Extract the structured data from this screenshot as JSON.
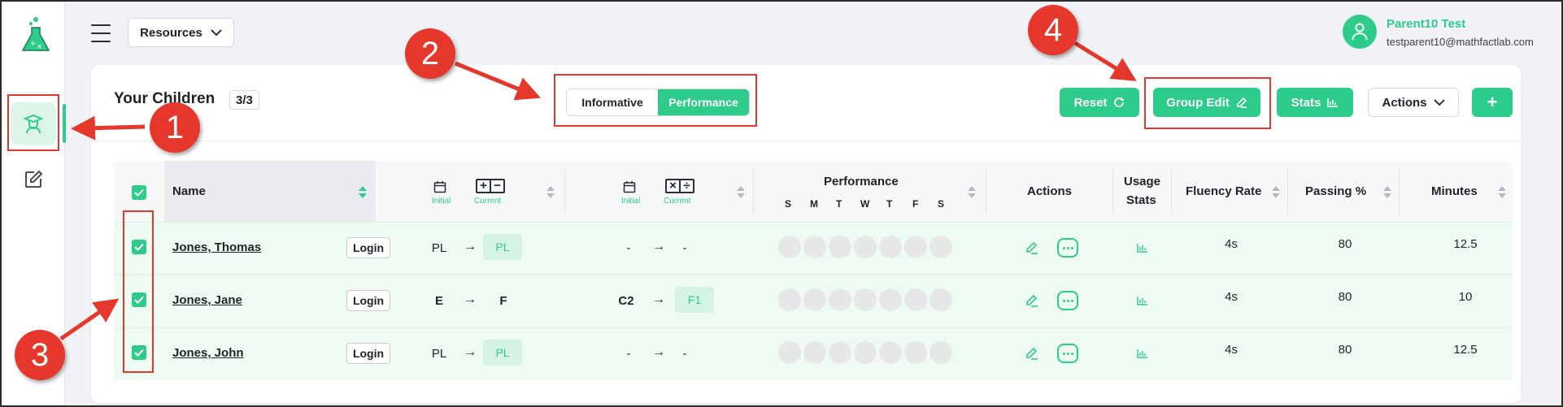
{
  "header": {
    "resources_label": "Resources",
    "user_name": "Parent10 Test",
    "user_email": "testparent10@mathfactlab.com"
  },
  "card": {
    "title": "Your Children",
    "count": "3/3",
    "view_toggle": [
      "Informative",
      "Performance"
    ],
    "active_view": "Performance",
    "buttons": {
      "reset": "Reset",
      "group_edit": "Group Edit",
      "stats": "Stats",
      "actions": "Actions",
      "add": "+"
    }
  },
  "table": {
    "headers": {
      "name": "Name",
      "performance": "Performance",
      "actions": "Actions",
      "usage_stats_1": "Usage",
      "usage_stats_2": "Stats",
      "fluency_rate": "Fluency Rate",
      "passing": "Passing %",
      "minutes": "Minutes",
      "initial": "Initial",
      "current": "Current",
      "days": [
        "S",
        "M",
        "T",
        "W",
        "T",
        "F",
        "S"
      ],
      "addsub_symbols": [
        "+",
        "−"
      ],
      "muldiv_symbols": [
        "×",
        "÷"
      ]
    },
    "rows": [
      {
        "name": "Jones, Thomas",
        "login": "Login",
        "as_initial": "PL",
        "as_current": "PL",
        "md_initial": "-",
        "md_current": "-",
        "fluency": "4s",
        "passing": "80",
        "minutes": "12.5"
      },
      {
        "name": "Jones, Jane",
        "login": "Login",
        "as_initial": "E",
        "as_current": "F",
        "md_initial": "C2",
        "md_current": "F1",
        "fluency": "4s",
        "passing": "80",
        "minutes": "10"
      },
      {
        "name": "Jones, John",
        "login": "Login",
        "as_initial": "PL",
        "as_current": "PL",
        "md_initial": "-",
        "md_current": "-",
        "fluency": "4s",
        "passing": "80",
        "minutes": "12.5"
      }
    ]
  },
  "annotations": [
    "1",
    "2",
    "3",
    "4"
  ],
  "colors": {
    "accent": "#2ecc8a",
    "annotation_red": "#e5372b",
    "row_bg": "#eefbf3"
  }
}
